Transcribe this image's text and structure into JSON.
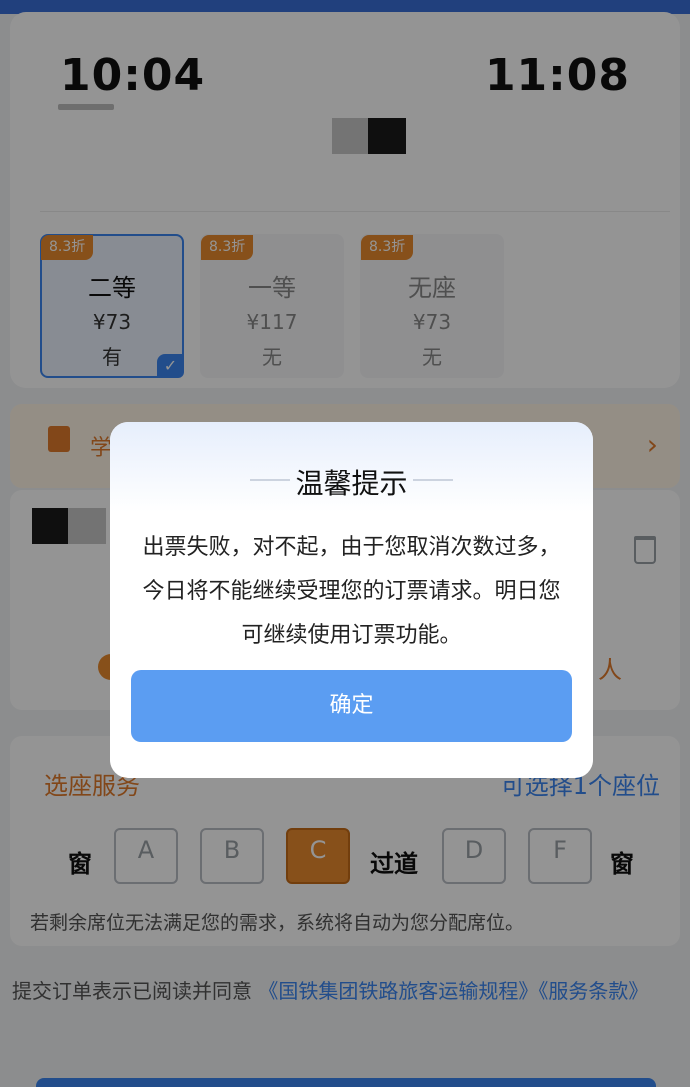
{
  "trip": {
    "depart_time": "10:04",
    "arrive_time": "11:08"
  },
  "seat_classes": [
    {
      "discount": "8.3折",
      "name": "二等",
      "price": "¥73",
      "availability": "有",
      "selected": true
    },
    {
      "discount": "8.3折",
      "name": "一等",
      "price": "¥117",
      "availability": "无",
      "selected": false
    },
    {
      "discount": "8.3折",
      "name": "无座",
      "price": "¥73",
      "availability": "无",
      "selected": false
    }
  ],
  "student": {
    "label": "学"
  },
  "passenger": {
    "add_label": "人"
  },
  "seat_service": {
    "title": "选座服务",
    "hint": "可选择1个座位",
    "window_left": "窗",
    "aisle": "过道",
    "window_right": "窗",
    "seats": [
      "A",
      "B",
      "C",
      "D",
      "F"
    ],
    "selected_seat": "C",
    "note": "若剩余席位无法满足您的需求，系统将自动为您分配席位。"
  },
  "agreement": {
    "prefix": "提交订单表示已阅读并同意",
    "link1": "《国铁集团铁路旅客运输规程》",
    "link2": "《服务条款》"
  },
  "dialog": {
    "title": "温馨提示",
    "message": "出票失败，对不起，由于您取消次数过多，今日将不能继续受理您的订票请求。明日您可继续使用订票功能。",
    "ok_label": "确定"
  },
  "colors": {
    "accent_blue": "#3b86f0",
    "accent_orange": "#e88a2e",
    "button_blue": "#5b9df2"
  }
}
